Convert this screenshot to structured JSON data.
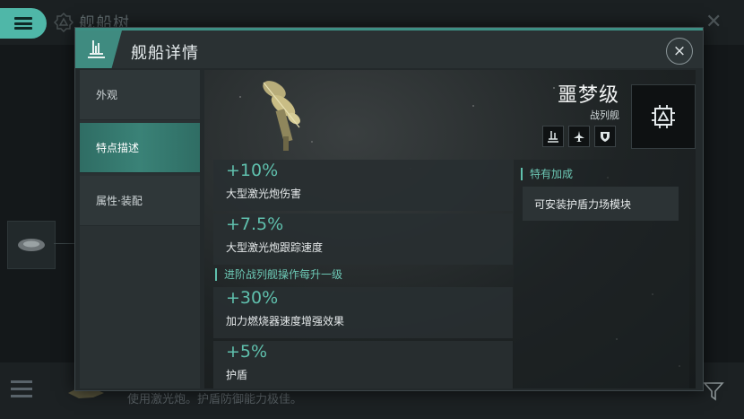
{
  "background": {
    "title": "舰船树",
    "description": "使用激光炮。护盾防御能力极佳。"
  },
  "modal": {
    "title": "舰船详情",
    "close_icon": "×"
  },
  "sidebar": {
    "items": [
      {
        "label": "外观",
        "active": false
      },
      {
        "label": "特点描述",
        "active": true
      },
      {
        "label": "属性·装配",
        "active": false
      }
    ]
  },
  "ship": {
    "name": "噩梦级",
    "class": "战列舰"
  },
  "bonuses": {
    "base": [
      {
        "value": "+10%",
        "text": "大型激光炮伤害"
      },
      {
        "value": "+7.5%",
        "text": "大型激光炮跟踪速度"
      }
    ],
    "level_heading": "进阶战列舰操作每升一级",
    "per_level": [
      {
        "value": "+30%",
        "text": "加力燃烧器速度增强效果"
      },
      {
        "value": "+5%",
        "text": "护盾"
      }
    ]
  },
  "special": {
    "heading": "特有加成",
    "items": [
      "可安装护盾力场模块"
    ]
  },
  "colors": {
    "accent": "#5fc0ad",
    "active_tab": "#3a8277",
    "menu_button": "#4fb7a8"
  }
}
